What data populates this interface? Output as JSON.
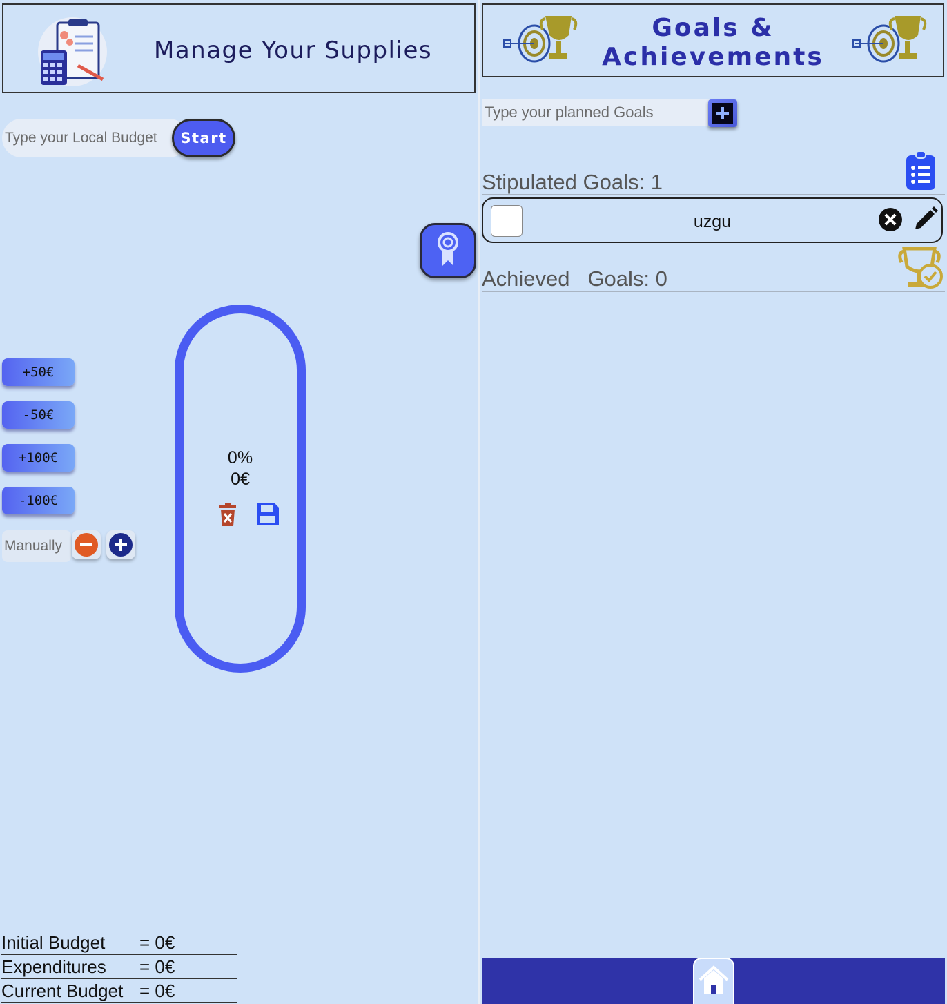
{
  "left": {
    "title": "Manage Your Supplies",
    "budget_placeholder": "Type your Local Budget",
    "start_label": "Start",
    "amount_buttons": [
      "+50€",
      "-50€",
      "+100€",
      "-100€"
    ],
    "manual_placeholder": "Manually",
    "jar": {
      "percent": "0%",
      "amount": "0€"
    },
    "summary": [
      {
        "label": "Initial Budget",
        "value": "= 0€"
      },
      {
        "label": "Expenditures",
        "value": "= 0€"
      },
      {
        "label": "Current Budget",
        "value": "= 0€"
      }
    ]
  },
  "right": {
    "title_line1": "Goals &",
    "title_line2": "Achievements",
    "goal_placeholder": "Type your planned Goals",
    "stipulated_label": "Stipulated Goals: 1",
    "goals": [
      {
        "text": "uzgu",
        "checked": false
      }
    ],
    "achieved_label": "Achieved   Goals: 0"
  },
  "colors": {
    "background": "#cfe2f8",
    "accent": "#4a5cf2",
    "title_blue": "#2b2fa8",
    "footer": "#2f33a8",
    "trophy_gold": "#c9a93a",
    "trash_red": "#b5462c",
    "minus_orange": "#e05a24"
  },
  "icons": {
    "header_left": "calculator-clipboard-icon",
    "award": "award-ribbon-icon",
    "trash": "trash-icon",
    "save": "floppy-save-icon",
    "minus": "minus-circle-icon",
    "plus": "plus-circle-icon",
    "trophy_target": "trophy-target-icon",
    "add_goal": "plus-square-icon",
    "clipboard_list": "clipboard-list-icon",
    "close": "close-circle-icon",
    "edit": "pencil-icon",
    "trophy_check": "trophy-check-icon",
    "home": "home-icon"
  }
}
